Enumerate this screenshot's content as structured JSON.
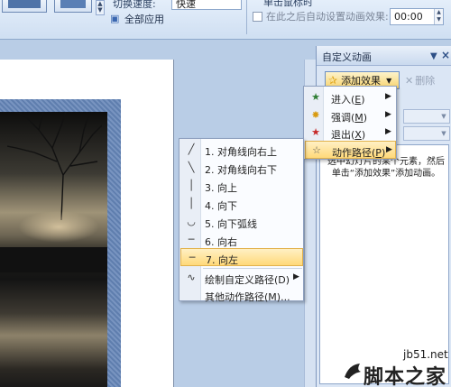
{
  "ribbon": {
    "speed_label": "切换速度:",
    "speed_value": "快速",
    "apply_all_label": "全部应用",
    "on_click_label": "单击鼠标时",
    "auto_label": "在此之后自动设置动画效果:",
    "auto_time": "00:00"
  },
  "pane": {
    "title": "自定义动画",
    "add_effect_label": "添加效果",
    "remove_label": "删除",
    "hint": "选中幻灯片的某个元素，然后单击“添加效果”添加动画。"
  },
  "effect_menu": {
    "items": [
      {
        "label": "进入",
        "key": "E",
        "icon": "entrance-star-icon",
        "color": "#2e7d32"
      },
      {
        "label": "强调",
        "key": "M",
        "icon": "emphasis-star-icon",
        "color": "#d89b12"
      },
      {
        "label": "退出",
        "key": "X",
        "icon": "exit-star-icon",
        "color": "#c62828"
      },
      {
        "label": "动作路径",
        "key": "P",
        "icon": "motion-path-star-icon",
        "color": "#555555"
      }
    ],
    "active_index": 3
  },
  "path_menu": {
    "items": [
      {
        "label": "1. 对角线向右上",
        "icon": "diagonal-up-right-icon"
      },
      {
        "label": "2. 对角线向右下",
        "icon": "diagonal-down-right-icon"
      },
      {
        "label": "3. 向上",
        "icon": "path-up-icon"
      },
      {
        "label": "4. 向下",
        "icon": "path-down-icon"
      },
      {
        "label": "5. 向下弧线",
        "icon": "arc-down-icon"
      },
      {
        "label": "6. 向右",
        "icon": "path-right-icon"
      },
      {
        "label": "7. 向左",
        "icon": "path-left-icon"
      },
      {
        "label": "绘制自定义路径(D)",
        "icon": "custom-path-icon"
      },
      {
        "label": "其他动作路径(M)...",
        "icon": ""
      }
    ],
    "active_index": 6
  },
  "watermark": {
    "url": "jb51.net",
    "name": "脚本之家"
  }
}
